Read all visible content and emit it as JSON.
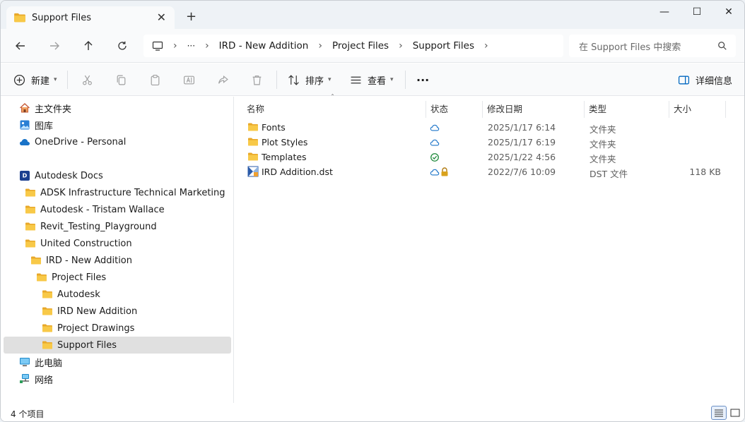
{
  "tab": {
    "title": "Support Files",
    "close_glyph": "✕",
    "new_tab_glyph": "+"
  },
  "window_controls": {
    "minimize": "—",
    "maximize": "☐",
    "close": "✕"
  },
  "breadcrumb": {
    "ellipsis": "···",
    "items": [
      "IRD - New Addition",
      "Project Files",
      "Support Files"
    ],
    "sep": "›"
  },
  "search": {
    "placeholder": "在 Support Files 中搜索"
  },
  "commands": {
    "new": "新建",
    "sort": "排序",
    "view": "查看",
    "more": "···",
    "details": "详细信息"
  },
  "nav": {
    "items": [
      {
        "label": "主文件夹",
        "icon": "home-icon"
      },
      {
        "label": "图库",
        "icon": "gallery-icon"
      },
      {
        "label": "OneDrive - Personal",
        "icon": "onedrive-cloud-icon"
      },
      {
        "label": "Autodesk Docs",
        "icon": "autodesk-docs-icon"
      },
      {
        "label": "ADSK Infrastructure Technical Marketing",
        "icon": "folder-icon"
      },
      {
        "label": "Autodesk - Tristam Wallace",
        "icon": "folder-icon"
      },
      {
        "label": "Revit_Testing_Playground",
        "icon": "folder-icon"
      },
      {
        "label": "United Construction",
        "icon": "folder-icon"
      },
      {
        "label": "IRD - New Addition",
        "icon": "folder-icon"
      },
      {
        "label": "Project Files",
        "icon": "folder-icon"
      },
      {
        "label": "Autodesk",
        "icon": "folder-icon"
      },
      {
        "label": "IRD New Addition",
        "icon": "folder-icon"
      },
      {
        "label": "Project Drawings",
        "icon": "folder-icon"
      },
      {
        "label": "Support Files",
        "icon": "folder-icon"
      },
      {
        "label": "此电脑",
        "icon": "computer-icon"
      },
      {
        "label": "网络",
        "icon": "network-icon"
      }
    ]
  },
  "columns": {
    "name": "名称",
    "status": "状态",
    "modified": "修改日期",
    "type": "类型",
    "size": "大小"
  },
  "files": [
    {
      "name": "Fonts",
      "status": "cloud",
      "modified": "2025/1/17 6:14",
      "type": "文件夹",
      "size": ""
    },
    {
      "name": "Plot Styles",
      "status": "cloud",
      "modified": "2025/1/17 6:19",
      "type": "文件夹",
      "size": ""
    },
    {
      "name": "Templates",
      "status": "synced",
      "modified": "2025/1/22 4:56",
      "type": "文件夹",
      "size": ""
    },
    {
      "name": "IRD Addition.dst",
      "status": "cloud-locked",
      "modified": "2022/7/6 10:09",
      "type": "DST 文件",
      "size": "118 KB"
    }
  ],
  "status_bar": {
    "count": "4 个项目"
  },
  "colors": {
    "folder": "#f4c64f",
    "cloud": "#1a73c8",
    "synced": "#1f8a3c",
    "accent": "#0067c0"
  }
}
